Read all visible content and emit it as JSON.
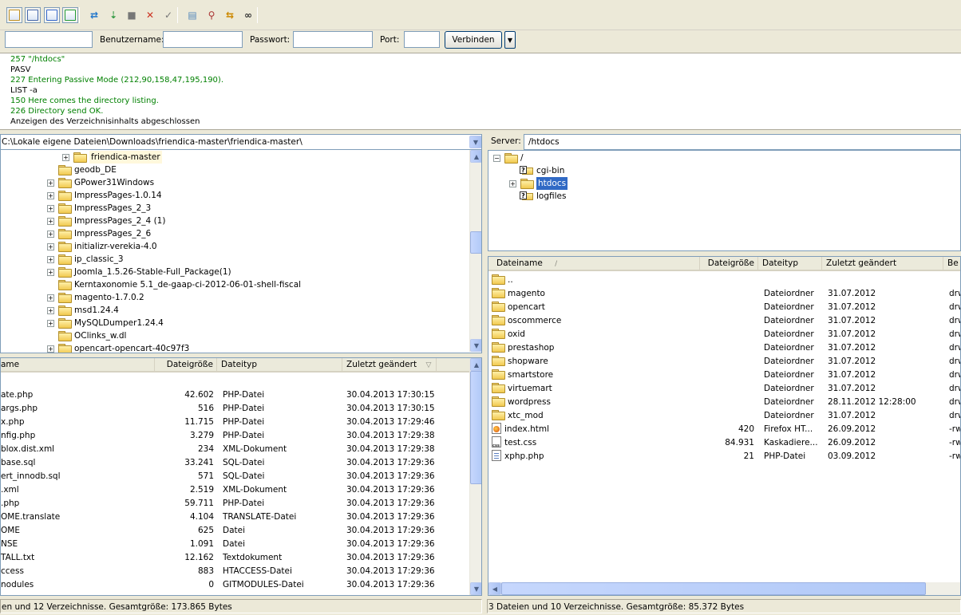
{
  "toolbar": {
    "icons": [
      "site-manager-icon",
      "toggle-log-icon",
      "toggle-local-tree-icon",
      "toggle-remote-tree-icon",
      "refresh-icon",
      "process-queue-icon",
      "stop-icon",
      "disconnect-icon",
      "reconnect-icon",
      "view-filter-icon",
      "compare-icon",
      "sync-browse-icon",
      "search-icon"
    ]
  },
  "quickconnect": {
    "host_value": "",
    "user_label": "Benutzername:",
    "user_value": "",
    "pass_label": "Passwort:",
    "pass_value": "",
    "port_label": "Port:",
    "port_value": "",
    "connect_label": "Verbinden",
    "dropdown_icon": "chevron-down-icon"
  },
  "log": [
    {
      "text": "257 \"/htdocs\"",
      "color": "#008000"
    },
    {
      "text": "PASV",
      "color": "#000000"
    },
    {
      "text": "227 Entering Passive Mode (212,90,158,47,195,190).",
      "color": "#008000"
    },
    {
      "text": "LIST -a",
      "color": "#000000"
    },
    {
      "text": "150 Here comes the directory listing.",
      "color": "#008000"
    },
    {
      "text": "226 Directory send OK.",
      "color": "#008000"
    },
    {
      "text": "Anzeigen des Verzeichnisinhalts abgeschlossen",
      "color": "#000000"
    }
  ],
  "local": {
    "path": "C:\\Lokale eigene Dateien\\Downloads\\friendica-master\\friendica-master\\",
    "tree": [
      {
        "label": "friendica-master",
        "expander": true,
        "hover": true
      },
      {
        "label": "geodb_DE",
        "expander": false
      },
      {
        "label": "GPower31Windows",
        "expander": true
      },
      {
        "label": "ImpressPages-1.0.14",
        "expander": true
      },
      {
        "label": "ImpressPages_2_3",
        "expander": true
      },
      {
        "label": "ImpressPages_2_4 (1)",
        "expander": true
      },
      {
        "label": "ImpressPages_2_6",
        "expander": true
      },
      {
        "label": "initializr-verekia-4.0",
        "expander": true
      },
      {
        "label": "ip_classic_3",
        "expander": true
      },
      {
        "label": "Joomla_1.5.26-Stable-Full_Package(1)",
        "expander": true
      },
      {
        "label": "Kerntaxonomie 5.1_de-gaap-ci-2012-06-01-shell-fiscal",
        "expander": false
      },
      {
        "label": "magento-1.7.0.2",
        "expander": true
      },
      {
        "label": "msd1.24.4",
        "expander": true
      },
      {
        "label": "MySQLDumper1.24.4",
        "expander": true
      },
      {
        "label": "OClinks_w.dl",
        "expander": false
      },
      {
        "label": "opencart-opencart-40c97f3",
        "expander": true
      }
    ],
    "columns": {
      "name": "ame",
      "size": "Dateigröße",
      "type": "Dateityp",
      "modified": "Zuletzt geändert",
      "sort_icon": "sort-desc-icon"
    },
    "files": [
      {
        "name": "ate.php",
        "size": "42.602",
        "type": "PHP-Datei",
        "modified": "30.04.2013 17:30:15"
      },
      {
        "name": "args.php",
        "size": "516",
        "type": "PHP-Datei",
        "modified": "30.04.2013 17:30:15"
      },
      {
        "name": "x.php",
        "size": "11.715",
        "type": "PHP-Datei",
        "modified": "30.04.2013 17:29:46"
      },
      {
        "name": "nfig.php",
        "size": "3.279",
        "type": "PHP-Datei",
        "modified": "30.04.2013 17:29:38"
      },
      {
        "name": "blox.dist.xml",
        "size": "234",
        "type": "XML-Dokument",
        "modified": "30.04.2013 17:29:38"
      },
      {
        "name": "base.sql",
        "size": "33.241",
        "type": "SQL-Datei",
        "modified": "30.04.2013 17:29:36"
      },
      {
        "name": "ert_innodb.sql",
        "size": "571",
        "type": "SQL-Datei",
        "modified": "30.04.2013 17:29:36"
      },
      {
        "name": ".xml",
        "size": "2.519",
        "type": "XML-Dokument",
        "modified": "30.04.2013 17:29:36"
      },
      {
        "name": ".php",
        "size": "59.711",
        "type": "PHP-Datei",
        "modified": "30.04.2013 17:29:36"
      },
      {
        "name": "OME.translate",
        "size": "4.104",
        "type": "TRANSLATE-Datei",
        "modified": "30.04.2013 17:29:36"
      },
      {
        "name": "OME",
        "size": "625",
        "type": "Datei",
        "modified": "30.04.2013 17:29:36"
      },
      {
        "name": "NSE",
        "size": "1.091",
        "type": "Datei",
        "modified": "30.04.2013 17:29:36"
      },
      {
        "name": "TALL.txt",
        "size": "12.162",
        "type": "Textdokument",
        "modified": "30.04.2013 17:29:36"
      },
      {
        "name": "ccess",
        "size": "883",
        "type": "HTACCESS-Datei",
        "modified": "30.04.2013 17:29:36"
      },
      {
        "name": "nodules",
        "size": "0",
        "type": "GITMODULES-Datei",
        "modified": "30.04.2013 17:29:36"
      }
    ],
    "status": "en und 12 Verzeichnisse. Gesamtgröße: 173.865 Bytes"
  },
  "remote": {
    "server_label": "Server:",
    "path": "/htdocs",
    "tree": [
      {
        "label": "/",
        "level": 0,
        "icon": "folder-icon",
        "expander": "minus"
      },
      {
        "label": "cgi-bin",
        "level": 1,
        "icon": "unknown-folder-icon",
        "expander": ""
      },
      {
        "label": "htdocs",
        "level": 1,
        "icon": "folder-icon",
        "expander": "plus",
        "selected": true
      },
      {
        "label": "logfiles",
        "level": 1,
        "icon": "unknown-folder-icon",
        "expander": ""
      }
    ],
    "columns": {
      "name": "Dateiname",
      "sort_icon": "sort-asc-icon",
      "size": "Dateigröße",
      "type": "Dateityp",
      "modified": "Zuletzt geändert",
      "perms": "Be"
    },
    "files": [
      {
        "name": "..",
        "size": "",
        "type": "",
        "modified": "",
        "perms": "",
        "icon": "folder-icon"
      },
      {
        "name": "magento",
        "size": "",
        "type": "Dateiordner",
        "modified": "31.07.2012",
        "perms": "drw",
        "icon": "folder-icon"
      },
      {
        "name": "opencart",
        "size": "",
        "type": "Dateiordner",
        "modified": "31.07.2012",
        "perms": "drw",
        "icon": "folder-icon"
      },
      {
        "name": "oscommerce",
        "size": "",
        "type": "Dateiordner",
        "modified": "31.07.2012",
        "perms": "drw",
        "icon": "folder-icon"
      },
      {
        "name": "oxid",
        "size": "",
        "type": "Dateiordner",
        "modified": "31.07.2012",
        "perms": "drw",
        "icon": "folder-icon"
      },
      {
        "name": "prestashop",
        "size": "",
        "type": "Dateiordner",
        "modified": "31.07.2012",
        "perms": "drw",
        "icon": "folder-icon"
      },
      {
        "name": "shopware",
        "size": "",
        "type": "Dateiordner",
        "modified": "31.07.2012",
        "perms": "drw",
        "icon": "folder-icon"
      },
      {
        "name": "smartstore",
        "size": "",
        "type": "Dateiordner",
        "modified": "31.07.2012",
        "perms": "drw",
        "icon": "folder-icon"
      },
      {
        "name": "virtuemart",
        "size": "",
        "type": "Dateiordner",
        "modified": "31.07.2012",
        "perms": "drw",
        "icon": "folder-icon"
      },
      {
        "name": "wordpress",
        "size": "",
        "type": "Dateiordner",
        "modified": "28.11.2012 12:28:00",
        "perms": "drw",
        "icon": "folder-icon"
      },
      {
        "name": "xtc_mod",
        "size": "",
        "type": "Dateiordner",
        "modified": "31.07.2012",
        "perms": "drw",
        "icon": "folder-icon"
      },
      {
        "name": "index.html",
        "size": "420",
        "type": "Firefox HT...",
        "modified": "26.09.2012",
        "perms": "-rw",
        "icon": "html-file-icon"
      },
      {
        "name": "test.css",
        "size": "84.931",
        "type": "Kaskadiere...",
        "modified": "26.09.2012",
        "perms": "-rw",
        "icon": "css-file-icon"
      },
      {
        "name": "xphp.php",
        "size": "21",
        "type": "PHP-Datei",
        "modified": "03.09.2012",
        "perms": "-rw",
        "icon": "php-file-icon"
      }
    ],
    "status": "3 Dateien und 10 Verzeichnisse. Gesamtgröße: 85.372 Bytes"
  }
}
